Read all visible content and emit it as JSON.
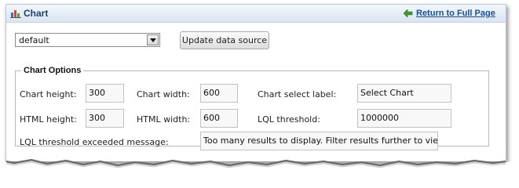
{
  "header": {
    "title": "Chart",
    "return_link": "Return to Full Page"
  },
  "toolbar": {
    "source_select": {
      "value": "default"
    },
    "update_button": "Update data source"
  },
  "chart_options": {
    "legend": "Chart Options",
    "chart_height": {
      "label": "Chart height:",
      "value": "300"
    },
    "chart_width": {
      "label": "Chart width:",
      "value": "600"
    },
    "chart_select_label": {
      "label": "Chart select label:",
      "value": "Select Chart"
    },
    "html_height": {
      "label": "HTML height:",
      "value": "300"
    },
    "html_width": {
      "label": "HTML width:",
      "value": "600"
    },
    "lql_threshold": {
      "label": "LQL threshold:",
      "value": "1000000"
    },
    "lql_message": {
      "label": "LQL threshold exceeded message:",
      "value": "Too many results to display. Filter results further to view chart"
    }
  },
  "icons": {
    "header": "bar-chart-icon",
    "return": "green-arrow-left-icon",
    "dropdown": "chevron-down-icon"
  },
  "colors": {
    "header_title": "#1f3e72",
    "link": "#1a4e9c",
    "header_gradient_top": "#f3f7fb",
    "header_gradient_bottom": "#d9e5f2",
    "panel_border": "#b9c8da"
  }
}
